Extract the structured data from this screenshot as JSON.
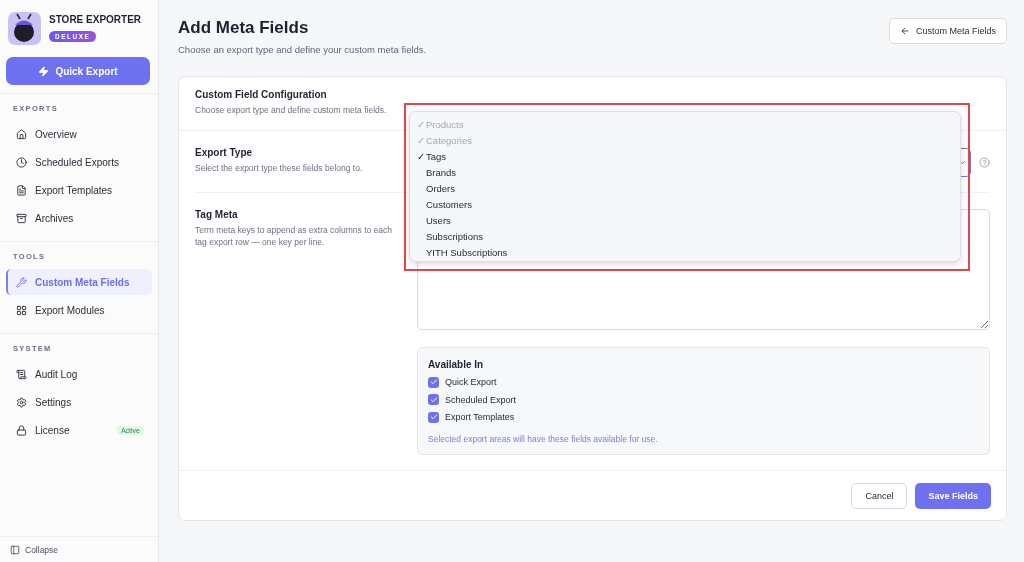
{
  "brand": {
    "name": "STORE EXPORTER",
    "badge": "DELUXE"
  },
  "quick_export": "Quick Export",
  "sidebar": {
    "sections": [
      {
        "title": "EXPORTS",
        "items": [
          {
            "label": "Overview",
            "selected": false
          },
          {
            "label": "Scheduled Exports",
            "selected": false
          },
          {
            "label": "Export Templates",
            "selected": false
          },
          {
            "label": "Archives",
            "selected": false
          }
        ]
      },
      {
        "title": "TOOLS",
        "items": [
          {
            "label": "Custom Meta Fields",
            "selected": true
          },
          {
            "label": "Export Modules",
            "selected": false
          }
        ]
      },
      {
        "title": "SYSTEM",
        "items": [
          {
            "label": "Audit Log",
            "selected": false
          },
          {
            "label": "Settings",
            "selected": false
          },
          {
            "label": "License",
            "selected": false,
            "badge": "Active"
          }
        ]
      }
    ],
    "collapse": "Collapse"
  },
  "page": {
    "title": "Add Meta Fields",
    "subtitle": "Choose an export type and define your custom meta fields.",
    "back_button": "Custom Meta Fields"
  },
  "card": {
    "title": "Custom Field Configuration",
    "subtitle": "Choose export type and define custom meta fields.",
    "export_type": {
      "label": "Export Type",
      "help": "Select the export type these fields belong to."
    },
    "tag_meta": {
      "label": "Tag Meta",
      "help": "Term meta keys to append as extra columns to each tag export row — one key per line."
    },
    "available_in": {
      "title": "Available In",
      "options": [
        {
          "label": "Quick Export",
          "checked": true
        },
        {
          "label": "Scheduled Export",
          "checked": true
        },
        {
          "label": "Export Templates",
          "checked": true
        }
      ],
      "note": "Selected export areas will have these fields available for use."
    },
    "buttons": {
      "cancel": "Cancel",
      "save": "Save Fields"
    }
  },
  "dropdown": {
    "check_glyph": "✓",
    "items": [
      {
        "label": "Products",
        "checked": true,
        "disabled": true
      },
      {
        "label": "Categories",
        "checked": true,
        "disabled": true
      },
      {
        "label": "Tags",
        "checked": true,
        "disabled": false
      },
      {
        "label": "Brands",
        "checked": false,
        "disabled": false
      },
      {
        "label": "Orders",
        "checked": false,
        "disabled": false
      },
      {
        "label": "Customers",
        "checked": false,
        "disabled": false
      },
      {
        "label": "Users",
        "checked": false,
        "disabled": false
      },
      {
        "label": "Subscriptions",
        "checked": false,
        "disabled": false
      },
      {
        "label": "YITH Subscriptions",
        "checked": false,
        "disabled": false
      }
    ]
  }
}
